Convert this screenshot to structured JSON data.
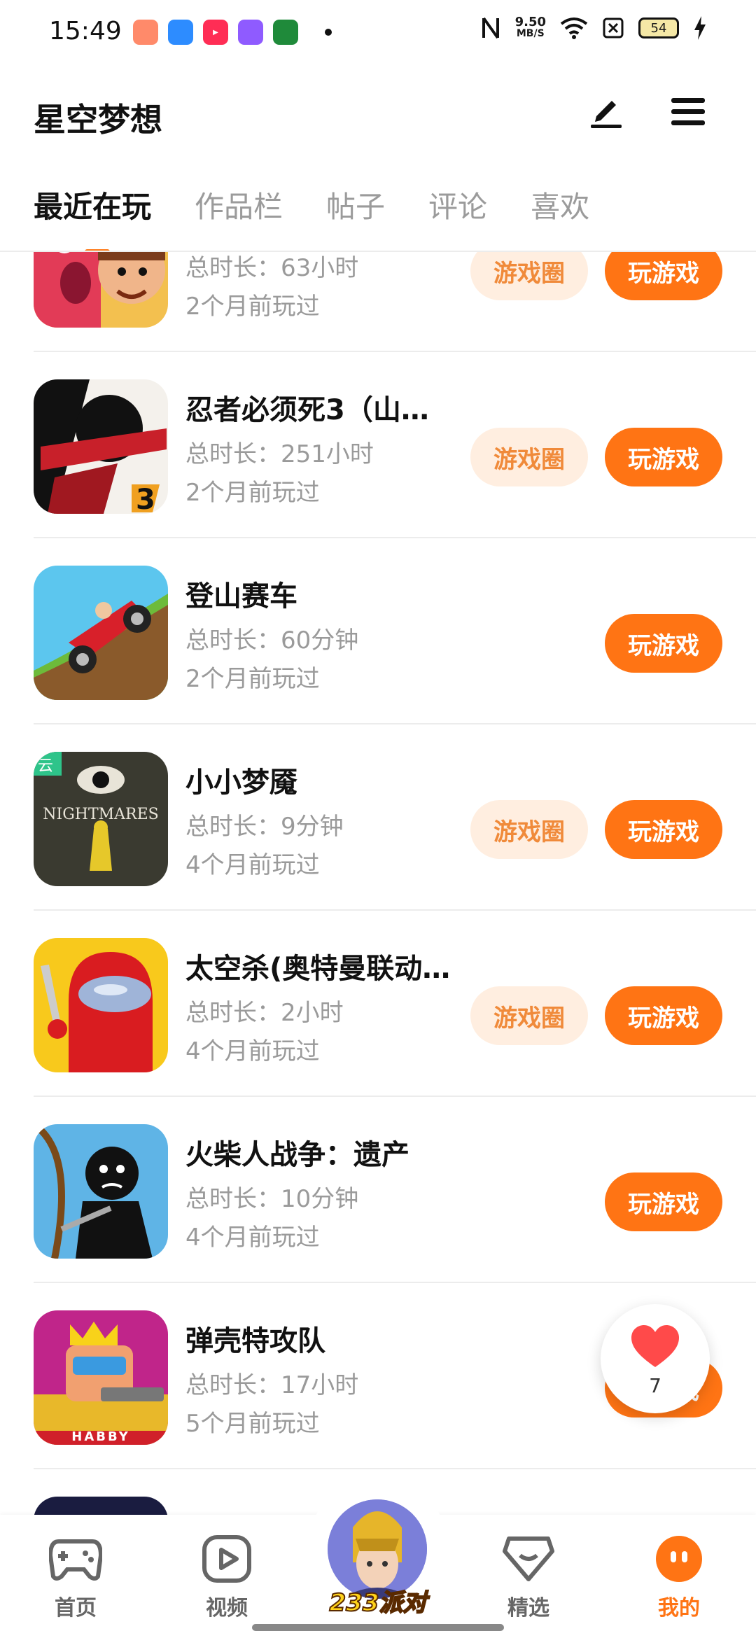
{
  "status_bar": {
    "time": "15:49",
    "net_speed_value": "9.50",
    "net_speed_unit": "MB/S",
    "battery": "54"
  },
  "header": {
    "title": "星空梦想"
  },
  "tabs": [
    {
      "label": "最近在玩",
      "active": true
    },
    {
      "label": "作品栏",
      "active": false
    },
    {
      "label": "帖子",
      "active": false
    },
    {
      "label": "评论",
      "active": false
    },
    {
      "label": "喜欢",
      "active": false
    }
  ],
  "games": [
    {
      "name": "",
      "duration": "总时长：63小时",
      "last_played": "2个月前玩过",
      "circle_label": "游戏圈",
      "play_label": "玩游戏"
    },
    {
      "name": "忍者必须死3（山…",
      "duration": "总时长：251小时",
      "last_played": "2个月前玩过",
      "circle_label": "游戏圈",
      "play_label": "玩游戏"
    },
    {
      "name": "登山赛车",
      "duration": "总时长：60分钟",
      "last_played": "2个月前玩过",
      "circle_label": "",
      "play_label": "玩游戏"
    },
    {
      "name": "小小梦魇",
      "duration": "总时长：9分钟",
      "last_played": "4个月前玩过",
      "circle_label": "游戏圈",
      "play_label": "玩游戏",
      "cloud_tag": "云"
    },
    {
      "name": "太空杀(奥特曼联动…",
      "duration": "总时长：2小时",
      "last_played": "4个月前玩过",
      "circle_label": "游戏圈",
      "play_label": "玩游戏"
    },
    {
      "name": "火柴人战争：遗产",
      "duration": "总时长：10分钟",
      "last_played": "4个月前玩过",
      "circle_label": "",
      "play_label": "玩游戏"
    },
    {
      "name": "弹壳特攻队",
      "duration": "总时长：17小时",
      "last_played": "5个月前玩过",
      "circle_label": "",
      "play_label": "玩游戏",
      "icon_caption": "HABBY"
    }
  ],
  "like_float": {
    "count": "7"
  },
  "bottom_nav": {
    "home": "首页",
    "video": "视频",
    "party": "233派对",
    "featured": "精选",
    "mine": "我的"
  }
}
